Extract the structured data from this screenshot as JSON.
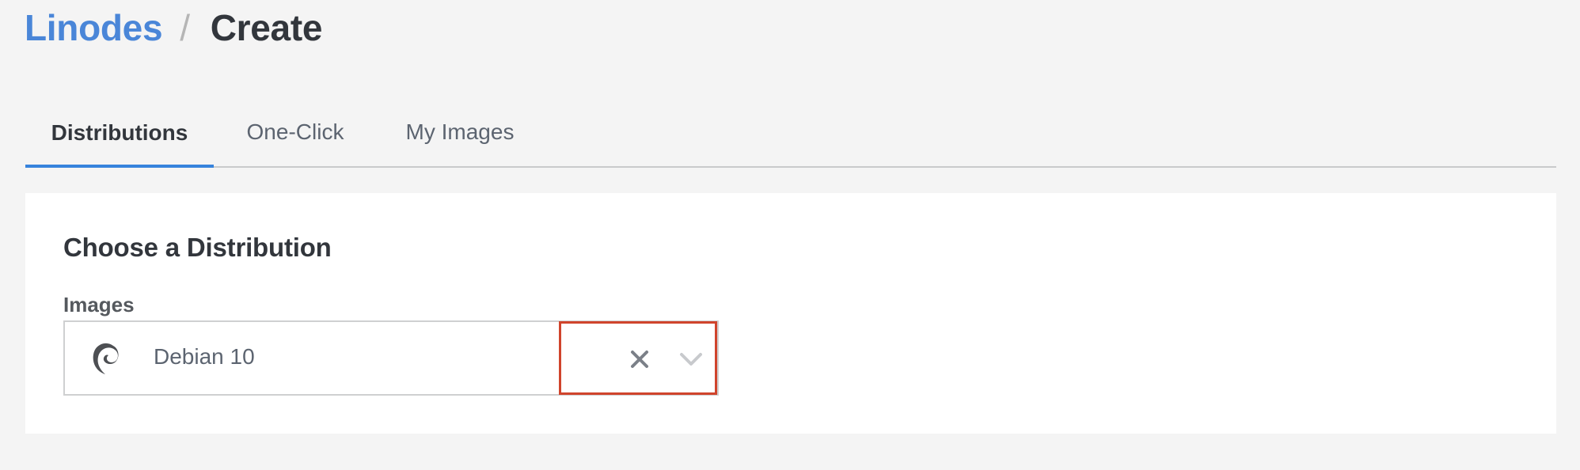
{
  "breadcrumb": {
    "parent_label": "Linodes",
    "separator": "/",
    "current_label": "Create"
  },
  "tabs": [
    {
      "label": "Distributions",
      "active": true
    },
    {
      "label": "One-Click",
      "active": false
    },
    {
      "label": "My Images",
      "active": false
    }
  ],
  "panel": {
    "title": "Choose a Distribution",
    "images_field": {
      "label": "Images",
      "selected_value": "Debian 10",
      "selected_icon": "debian-swirl-icon",
      "clear_icon": "close-icon",
      "dropdown_icon": "chevron-down-icon"
    }
  },
  "colors": {
    "accent": "#3683dc",
    "link": "#4a86d8",
    "highlight_box": "#d0442c",
    "background": "#f4f4f4",
    "panel": "#ffffff",
    "text_dark": "#32363c",
    "text_muted": "#5c6470"
  }
}
